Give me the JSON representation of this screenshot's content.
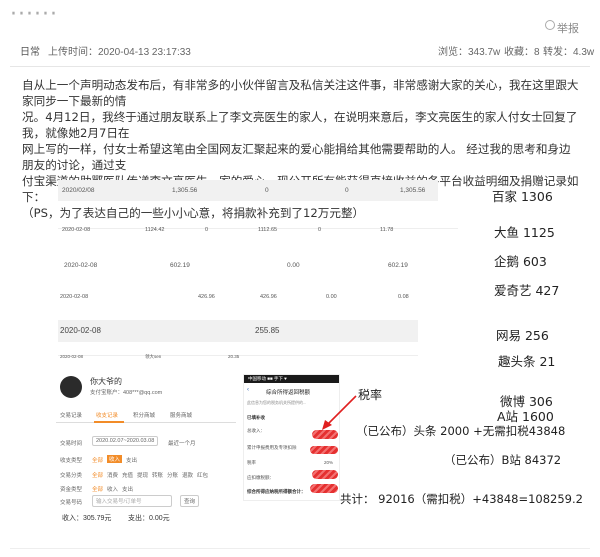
{
  "header": {
    "report_label": "举报"
  },
  "meta": {
    "category": "日常",
    "upload_time": "上传时间：2020-04-13 23:17:33",
    "views": "浏览：343.7w",
    "favorites": "收藏：8",
    "shares": "转发：4.3w"
  },
  "article": {
    "line1": "自从上一个声明动态发布后，有非常多的小伙伴留言及私信关注这件事，非常感谢大家的关心，我在这里跟大家同步一下最新的情",
    "line2": "况。4月12日，我终于通过朋友联系上了李文亮医生的家人，在说明来意后，李文亮医生的家人付女士回复了我，就像她2月7日在",
    "line3": "网上写的一样，付女士希望这笔由全国网友汇聚起来的爱心能捐给其他需要帮助的人。 经过我的思考和身边朋友的讨论，通过支",
    "line4": "付宝渠道的助鄂医队传递李文亮医生一家的爱心，现公开所有能获得直接收益的各平台收益明细及捐赠记录如下：",
    "line5": "（PS，为了表达自己的一些小小心意，将捐款补充到了12万元整）"
  },
  "income_rows": [
    {
      "date": "2020/02/08",
      "c1": "1,305.56",
      "c2": "0",
      "c3": "0",
      "c4": "1,305.56",
      "platform": "百家  1306"
    },
    {
      "date": "2020-02-08",
      "c1": "1124.42",
      "c2": "0",
      "c3": "1112.65",
      "c4": "0",
      "c5": "11.78",
      "platform": "大鱼  1125"
    },
    {
      "date": "2020-02-08",
      "c1": "602.19",
      "c2": "0.00",
      "c3": "602.19",
      "platform": "企鹅  603"
    },
    {
      "date": "2020-02-08",
      "c1": "426.96",
      "c2": "426.96",
      "c3": "0.00",
      "c4": "0.08",
      "platform": "爱奇艺  427"
    },
    {
      "date": "2020-02-08",
      "c1": "255.85",
      "platform": "网易 256"
    },
    {
      "date": "2020-02-08",
      "c1": "领大sen",
      "c2": "20.35",
      "platform": "趣头条 21"
    }
  ],
  "screenshot_left": {
    "username": "你大爷的",
    "subline": "支付宝账户：408***@qq.com",
    "tabs": [
      "交易记录",
      "收支记录",
      "积分商城",
      "服务商城"
    ],
    "date_label": "交易时间",
    "date_range": "2020.02.07~2020.03.08",
    "date_preset": "最近一个月",
    "type_label": "收支类型",
    "type_options": [
      "全部",
      "收入",
      "支出"
    ],
    "cat_label": "交易分类",
    "cat_options": [
      "全部",
      "消费",
      "充值",
      "提现",
      "转账",
      "分账",
      "退款",
      "红包"
    ],
    "amount_label": "资金类型",
    "amount_options": [
      "全部",
      "收入",
      "支出"
    ],
    "number_label": "交易号码",
    "number_placeholder": "输入交易号/订单号",
    "search_label": "查询",
    "income_text": "收入：305.79元",
    "expense_text": "支出：0.00元"
  },
  "screenshot_right": {
    "status": "中国移动 ■■ 手下 ♥",
    "title": "综合所得返回税额",
    "note": "此信息为您的税务机关所提供的...",
    "section": "已填补收",
    "row1": "总收入：",
    "row2": "累计申报费用及专项扣除",
    "row3": "税率",
    "row3_val": "20%",
    "row4": "应扣缴税额：",
    "footer": "综合所得应纳税所得额合计："
  },
  "annotations": {
    "tax_rate": "税率",
    "weibo": "微博   306",
    "a_station": "A站   1600",
    "toutiao": "（已公布）头条 2000  +无需扣税43848",
    "bilibili": "（已公布）B站 84372",
    "total": "共计：  92016（需扣税）+43848=108259.2"
  },
  "colors": {
    "accent": "#f28c28",
    "red": "#e02020",
    "blue": "#2d5fb0"
  }
}
